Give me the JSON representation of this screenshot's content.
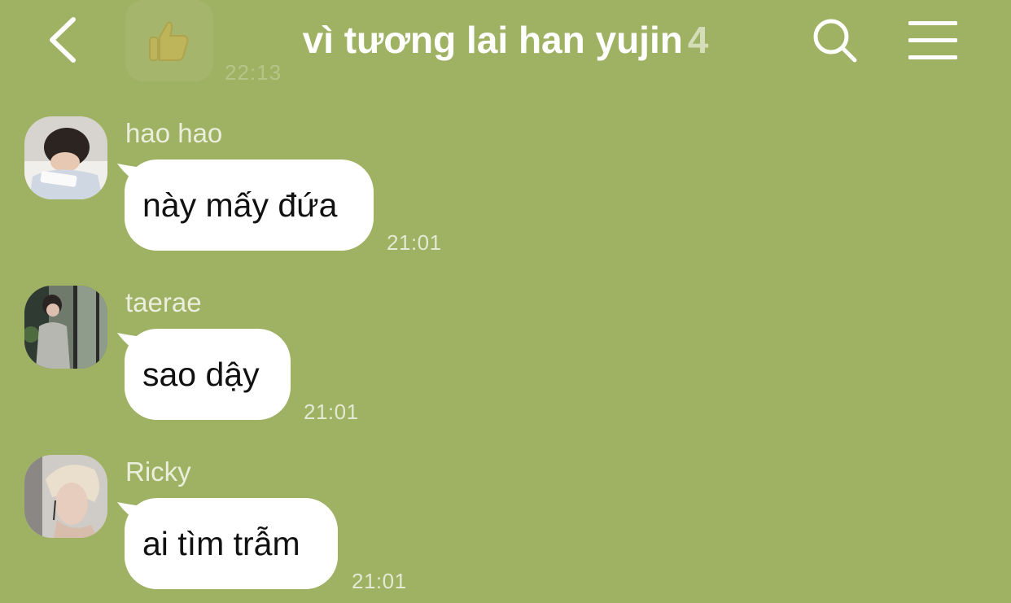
{
  "header": {
    "title": "vì tương lai han yujin",
    "member_count": "4",
    "previous_message_time": "22:13",
    "icons": {
      "back": "chevron-left-icon",
      "search": "search-icon",
      "menu": "hamburger-menu-icon",
      "sticker": "thumbs-up-icon"
    }
  },
  "messages": [
    {
      "sender": "hao hao",
      "text": "này mấy đứa",
      "time": "21:01",
      "avatar": "avatar-hao-hao"
    },
    {
      "sender": "taerae",
      "text": "sao dậy",
      "time": "21:01",
      "avatar": "avatar-taerae"
    },
    {
      "sender": "Ricky",
      "text": "ai tìm trẫm",
      "time": "21:01",
      "avatar": "avatar-ricky"
    }
  ],
  "colors": {
    "background": "#9fb162",
    "bubble": "#ffffff",
    "text": "#111111"
  }
}
